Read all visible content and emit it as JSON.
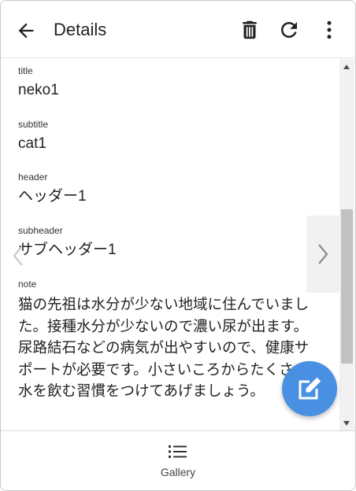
{
  "header": {
    "title": "Details"
  },
  "fields": {
    "title": {
      "label": "title",
      "value": "neko1"
    },
    "subtitle": {
      "label": "subtitle",
      "value": "cat1"
    },
    "header": {
      "label": "header",
      "value": "ヘッダー1"
    },
    "subheader": {
      "label": "subheader",
      "value": "サブヘッダー1"
    },
    "note": {
      "label": "note",
      "value": "猫の先祖は水分が少ない地域に住んでいました。接種水分が少ないので濃い尿が出ます。尿路結石などの病気が出やすいので、健康サポートが必要です。小さいころからたくさん水を飲む習慣をつけてあげましょう。"
    }
  },
  "bottom_nav": {
    "gallery_label": "Gallery"
  },
  "colors": {
    "fab": "#4a90e2",
    "icon": "#222222"
  },
  "icons": {
    "back": "arrow-left-icon",
    "delete": "trash-icon",
    "refresh": "refresh-icon",
    "more": "more-vertical-icon",
    "prev": "chevron-left-icon",
    "next": "chevron-right-icon",
    "edit": "edit-icon",
    "gallery": "list-icon"
  }
}
